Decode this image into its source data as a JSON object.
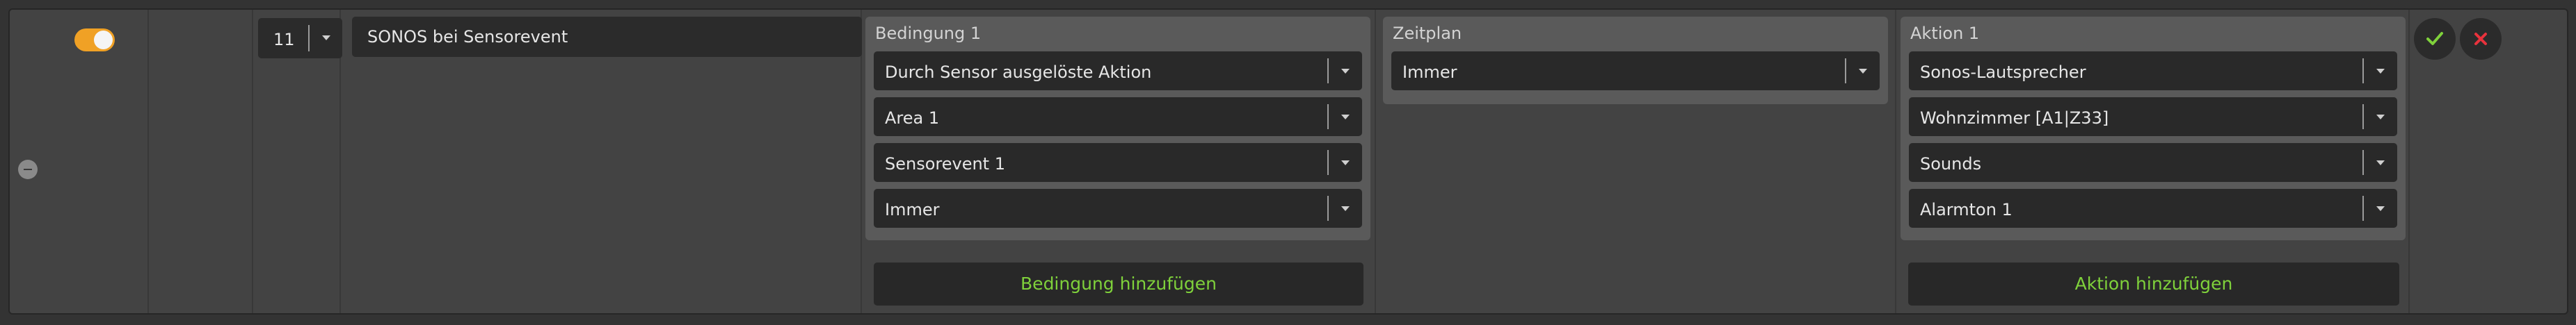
{
  "rule": {
    "enabled": true,
    "number": "11",
    "name": "SONOS bei Sensorevent"
  },
  "condition": {
    "title": "Bedingung 1",
    "selects": [
      "Durch Sensor ausgelöste Aktion",
      "Area 1",
      "Sensorevent 1",
      "Immer"
    ],
    "add_label": "Bedingung hinzufügen"
  },
  "schedule": {
    "title": "Zeitplan",
    "selects": [
      "Immer"
    ]
  },
  "action": {
    "title": "Aktion 1",
    "selects": [
      "Sonos-Lautsprecher",
      "Wohnzimmer [A1|Z33]",
      "Sounds",
      "Alarmton 1"
    ],
    "add_label": "Aktion hinzufügen"
  },
  "colors": {
    "toggle_on": "#f0a125",
    "confirm": "#7fd13b",
    "cancel": "#e8323c",
    "add_text": "#7fd13b"
  },
  "icons": {
    "confirm": "check-icon",
    "cancel": "close-icon",
    "collapse": "minus-icon",
    "dropdown": "chevron-down-icon"
  }
}
